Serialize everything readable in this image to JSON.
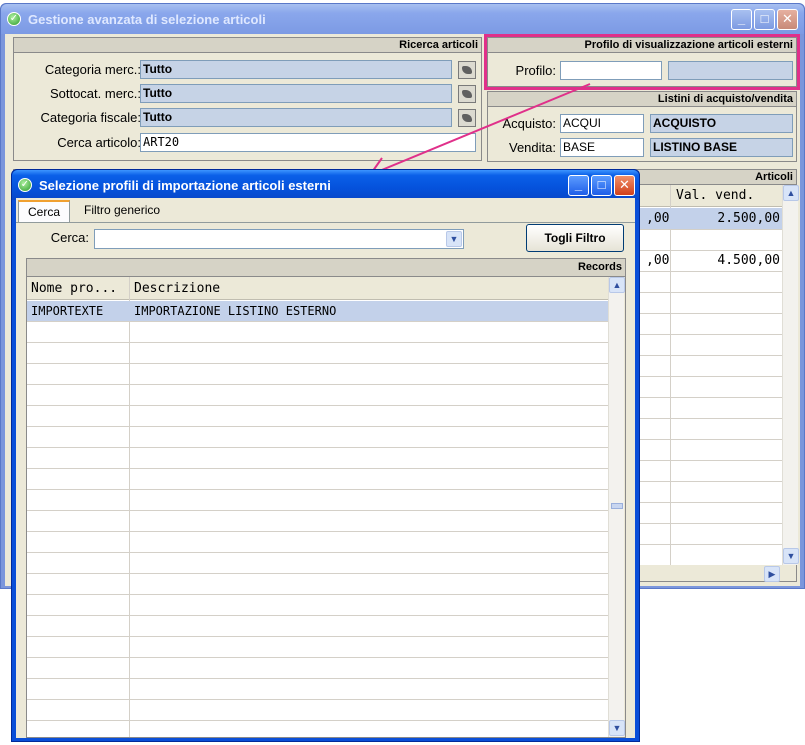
{
  "main_window": {
    "title": "Gestione avanzata di selezione articoli",
    "search_panel": {
      "header": "Ricerca articoli",
      "rows": [
        {
          "label": "Categoria merc.:",
          "value": "Tutto"
        },
        {
          "label": "Sottocat. merc.:",
          "value": "Tutto"
        },
        {
          "label": "Categoria fiscale:",
          "value": "Tutto"
        }
      ],
      "cerca_label": "Cerca articolo:",
      "cerca_value": "ART20"
    },
    "profile_panel": {
      "header": "Profilo di visualizzazione articoli esterni",
      "profilo_label": "Profilo:",
      "profilo_value": "",
      "profilo_desc": ""
    },
    "price_panel": {
      "header": "Listini di acquisto/vendita",
      "acquisto_label": "Acquisto:",
      "acquisto_code": "ACQUI",
      "acquisto_desc": "ACQUISTO",
      "vendita_label": "Vendita:",
      "vendita_code": "BASE",
      "vendita_desc": "LISTINO BASE"
    },
    "articles_panel": {
      "header": "Articoli",
      "column_header": "Val. vend.",
      "rows": [
        {
          "left": ",00",
          "value": "2.500,00"
        },
        {
          "left": "",
          "value": ""
        },
        {
          "left": ",00",
          "value": "4.500,00"
        }
      ]
    }
  },
  "dialog": {
    "title": "Selezione profili di importazione articoli esterni",
    "tabs": [
      "Cerca",
      "Filtro generico"
    ],
    "cerca_label": "Cerca:",
    "cerca_value": "",
    "filter_button": "Togli Filtro",
    "records_header": "Records",
    "columns": [
      "Nome pro...",
      "Descrizione"
    ],
    "rows": [
      {
        "name": "IMPORTEXTE",
        "descr": "IMPORTAZIONE LISTINO ESTERNO"
      }
    ]
  },
  "colors": {
    "highlight": "#e0308a",
    "selected_row": "#c3d1ea"
  }
}
